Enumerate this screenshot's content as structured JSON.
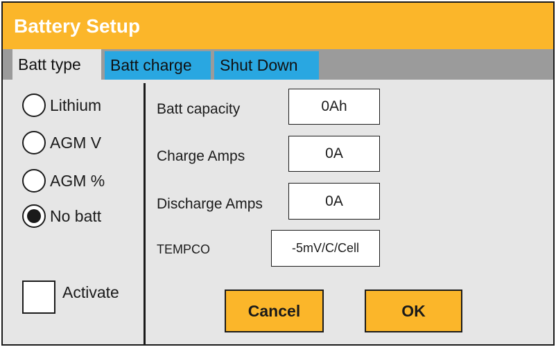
{
  "window": {
    "title": "Battery Setup"
  },
  "tabs": [
    {
      "label": "Batt type",
      "active": true
    },
    {
      "label": "Batt charge",
      "active": false
    },
    {
      "label": "Shut Down",
      "active": false
    }
  ],
  "battery_types": [
    {
      "label": "Lithium",
      "selected": false
    },
    {
      "label": "AGM V",
      "selected": false
    },
    {
      "label": "AGM %",
      "selected": false
    },
    {
      "label": "No batt",
      "selected": true
    }
  ],
  "activate": {
    "label": "Activate",
    "checked": false
  },
  "fields": {
    "capacity": {
      "label": "Batt capacity",
      "value": "0Ah"
    },
    "charge_amps": {
      "label": "Charge Amps",
      "value": "0A"
    },
    "discharge_amps": {
      "label": "Discharge Amps",
      "value": "0A"
    },
    "tempco": {
      "label": "TEMPCO",
      "value": "-5mV/C/Cell"
    }
  },
  "buttons": {
    "cancel": "Cancel",
    "ok": "OK"
  },
  "colors": {
    "accent": "#fbb62a",
    "tab_inactive": "#29a7e1",
    "tabbar": "#9b9b9b",
    "panel": "#e6e6e6"
  }
}
